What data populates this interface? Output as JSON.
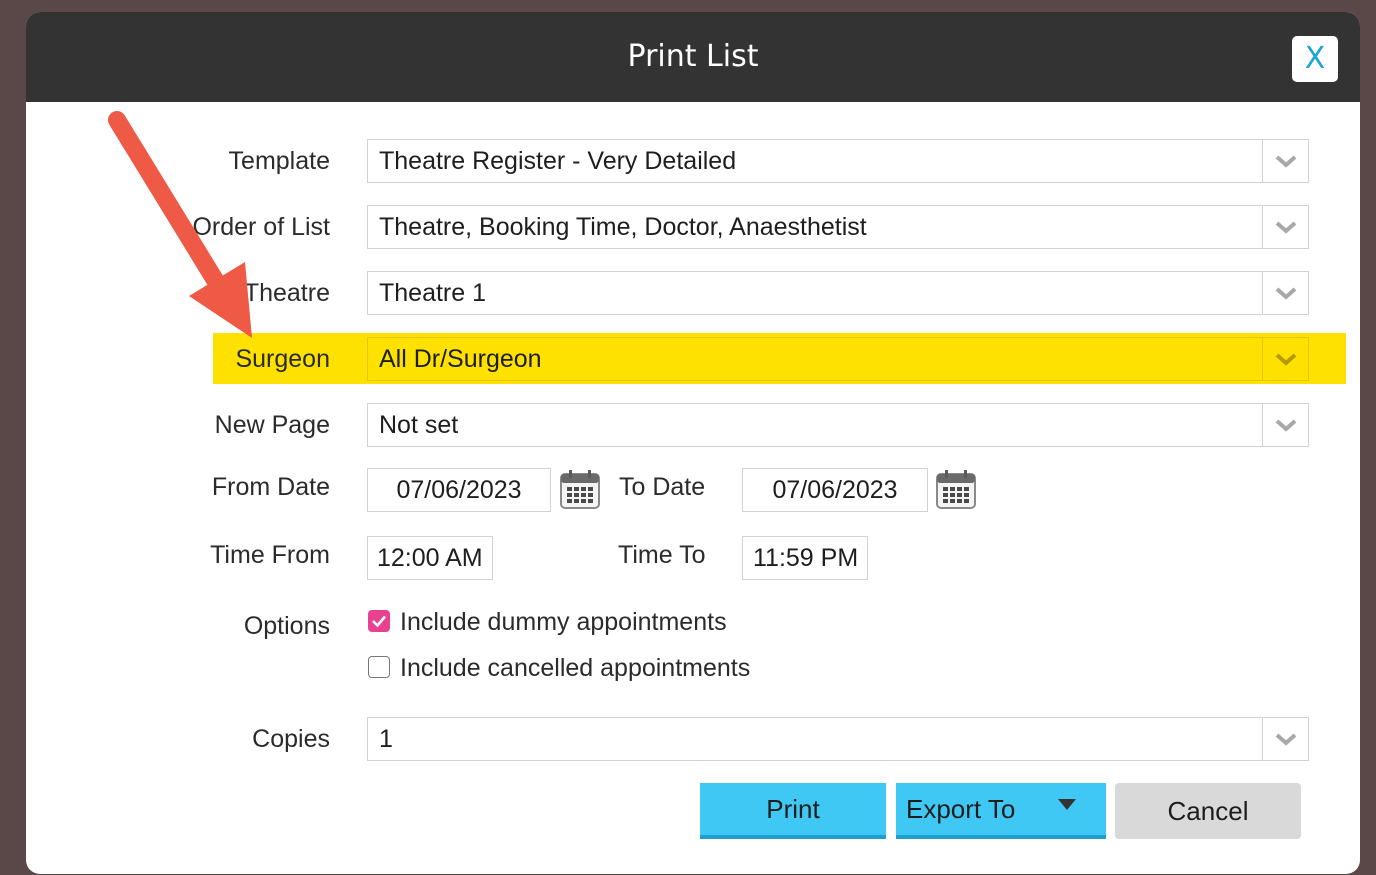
{
  "dialog": {
    "title": "Print List",
    "close_label": "X"
  },
  "fields": {
    "template": {
      "label": "Template",
      "value": "Theatre Register - Very Detailed"
    },
    "order": {
      "label": "Order of List",
      "value": "Theatre, Booking Time, Doctor, Anaesthetist"
    },
    "theatre": {
      "label": "Theatre",
      "value": "Theatre 1"
    },
    "surgeon": {
      "label": "Surgeon",
      "value": "All Dr/Surgeon"
    },
    "new_page": {
      "label": "New Page",
      "value": "Not set"
    },
    "from_date": {
      "label": "From Date",
      "value": "07/06/2023"
    },
    "to_date": {
      "label": "To Date",
      "value": "07/06/2023"
    },
    "time_from": {
      "label": "Time From",
      "value": "12:00 AM"
    },
    "time_to": {
      "label": "Time To",
      "value": "11:59 PM"
    },
    "options": {
      "label": "Options",
      "dummy": {
        "label": "Include dummy appointments",
        "checked": true
      },
      "cancelled": {
        "label": "Include cancelled appointments",
        "checked": false
      }
    },
    "copies": {
      "label": "Copies",
      "value": "1"
    }
  },
  "buttons": {
    "print": "Print",
    "export": "Export To",
    "cancel": "Cancel"
  },
  "colors": {
    "highlight": "#ffe100",
    "annotation_arrow": "#ef5a47",
    "button_blue": "#40c8f4",
    "checkbox_checked": "#e8418f"
  },
  "icons": {
    "dropdown": "chevron-down-icon",
    "calendar": "calendar-icon",
    "checkmark": "checkmark-icon",
    "export_caret": "caret-down-icon",
    "annotation": "annotation-arrow"
  }
}
